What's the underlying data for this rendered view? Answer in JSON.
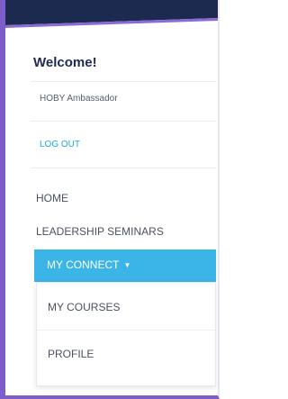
{
  "colors": {
    "header_navy": "#1c2a4f",
    "frame_purple": "#7d5dc9",
    "accent_blue": "#3bb4e8",
    "link_blue": "#1da8e3"
  },
  "menu": {
    "welcome": "Welcome!",
    "role": "HOBY Ambassador",
    "logout": "LOG OUT",
    "nav": {
      "home": "HOME",
      "seminars": "LEADERSHIP SEMINARS",
      "my_connect": "MY CONNECT",
      "my_connect_caret": "▼"
    },
    "submenu": {
      "my_courses": "MY COURSES",
      "profile": "PROFILE"
    }
  }
}
